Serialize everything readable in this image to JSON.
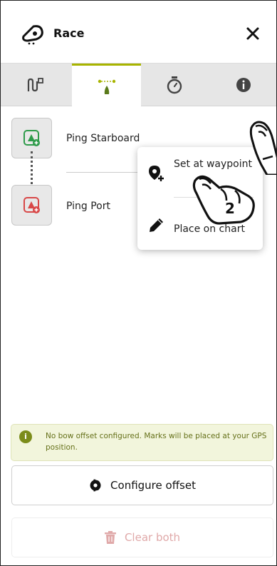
{
  "header": {
    "title": "Race",
    "logo_icon": "sailboat-logo-icon",
    "close_icon": "close-icon"
  },
  "tabs": [
    {
      "icon": "route-icon",
      "active": false
    },
    {
      "icon": "start-line-icon",
      "active": true
    },
    {
      "icon": "timer-icon",
      "active": false
    },
    {
      "icon": "info-icon",
      "active": false
    }
  ],
  "pings": {
    "starboard": {
      "label": "Ping Starboard",
      "color": "#2e9b4a"
    },
    "port": {
      "label": "Ping Port",
      "color": "#d84848"
    }
  },
  "popup_menu": {
    "items": [
      {
        "label": "Set at waypoint",
        "icon": "waypoint-pin-icon"
      },
      {
        "label": "Place on chart",
        "icon": "pencil-icon"
      }
    ]
  },
  "gesture_hints": [
    {
      "label": "",
      "icon": "hand-pointer-icon"
    },
    {
      "label": "2",
      "icon": "hand-pointer-icon"
    }
  ],
  "info_notice": {
    "text": "No bow offset configured. Marks will be placed at your GPS position."
  },
  "configure_button": {
    "label": "Configure offset"
  },
  "clear_button": {
    "label": "Clear both"
  },
  "colors": {
    "accent": "#a8b400",
    "starboard": "#2e9b4a",
    "port": "#d84848",
    "info_bg": "#f2f5dc",
    "clear_text": "#e0a9a9"
  }
}
